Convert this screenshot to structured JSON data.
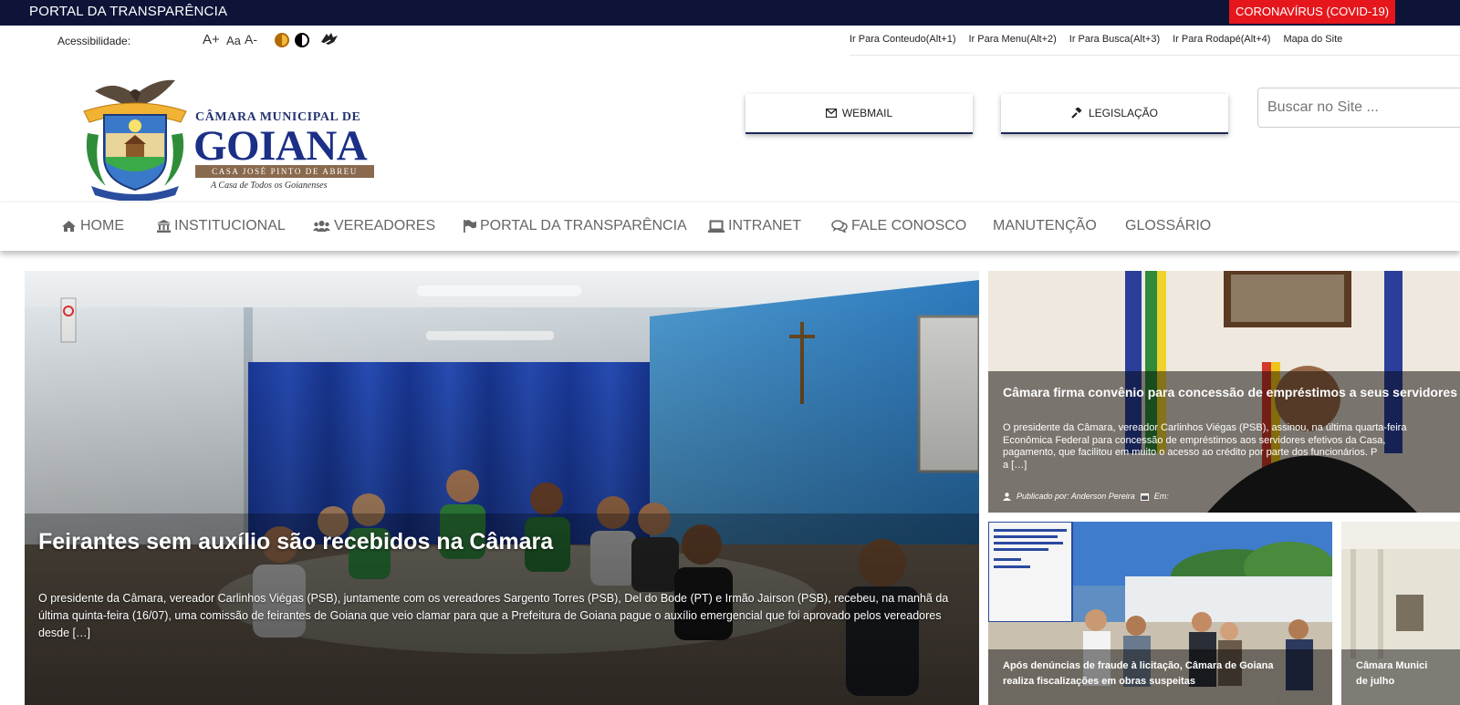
{
  "topbar": {
    "brand": "PORTAL  DA TRANSPARÊNCIA",
    "covid_button": "CORONAVÍRUS (COVID-19)"
  },
  "accessibility": {
    "label": "Acessibilidade:",
    "font_increase": "A+",
    "font_reset": "Aa",
    "font_decrease": "A-",
    "skip_links": [
      "Ir Para Conteudo(Alt+1)",
      "Ir Para Menu(Alt+2)",
      "Ir Para Busca(Alt+3)",
      "Ir Para Rodapé(Alt+4)",
      "Mapa do Site"
    ]
  },
  "logo": {
    "line1": "CÂMARA MUNICIPAL DE",
    "line2": "GOIANA",
    "line3": "CASA JOSÉ PINTO DE ABREU",
    "line4": "A Casa de Todos os Goianenses",
    "ribbon_text": "GOYANNA"
  },
  "header": {
    "webmail_label": "WEBMAIL",
    "legislacao_label": "LEGISLAÇÃO",
    "search_placeholder": "Buscar no Site ..."
  },
  "nav": {
    "items": [
      {
        "label": "HOME",
        "icon": "home-icon"
      },
      {
        "label": "INSTITUCIONAL",
        "icon": "institution-icon"
      },
      {
        "label": "VEREADORES",
        "icon": "users-icon"
      },
      {
        "label": "PORTAL DA TRANSPARÊNCIA",
        "icon": "flag-icon"
      },
      {
        "label": "INTRANET",
        "icon": "laptop-icon"
      },
      {
        "label": "FALE CONOSCO",
        "icon": "comments-icon"
      },
      {
        "label": "MANUTENÇÃO",
        "icon": ""
      },
      {
        "label": "GLOSSÁRIO",
        "icon": ""
      }
    ]
  },
  "hero": {
    "title": "Feirantes sem auxílio são recebidos na Câmara",
    "excerpt": "O presidente da Câmara, vereador Carlinhos Viégas (PSB), juntamente com os vereadores Sargento Torres (PSB), Del do Bode (PT) e Irmão Jairson (PSB), recebeu, na manhã da última quinta-feira (16/07), uma comissão de feirantes de Goiana que veio clamar para que a Prefeitura de Goiana pague o auxílio emergencial que foi aprovado pelos vereadores desde […]"
  },
  "side_top": {
    "title": "Câmara firma convênio para concessão de empréstimos a seus servidores",
    "excerpt_lines": [
      "O presidente da Câmara, vereador Carlinhos Viégas (PSB), assinou, na última quarta-feira",
      "Econômica Federal para concessão de empréstimos aos servidores efetivos da Casa,",
      "pagamento, que facilitou em muito o acesso ao crédito por parte dos funcionários. P",
      "a […]"
    ],
    "meta_author": "Publicado por: Anderson Pereira",
    "meta_date": "Em:"
  },
  "side_bottom_left": {
    "title_lines": [
      "Após denúncias de fraude à licitação, Câmara de Goiana",
      "realiza fiscalizações em obras suspeitas"
    ],
    "sign_text": "REFORMA/REVITALIZAÇÃO DA PRAÇA DA ESCOLA LOURENÇO BARBOSA DISTRITO DE CARNE DE VACA - GOIANA - PE"
  },
  "side_bottom_right": {
    "title_lines": [
      "Câmara Munici",
      "de julho"
    ]
  }
}
